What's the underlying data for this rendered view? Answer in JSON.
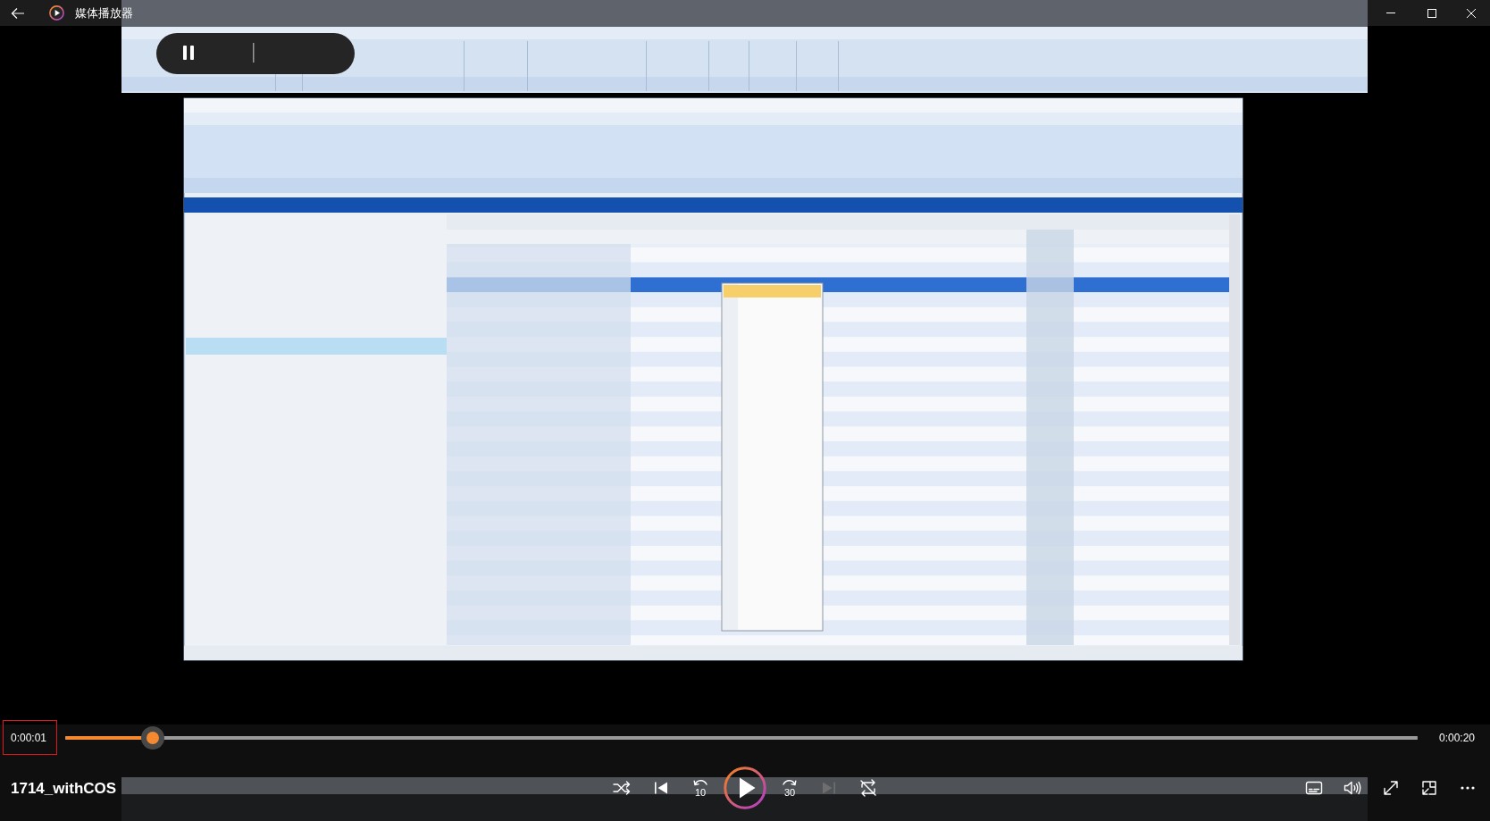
{
  "window": {
    "title": "媒体播放器"
  },
  "player": {
    "current_time": {
      "text": "0:00:01",
      "highlighted": true
    },
    "progress": {
      "level": 0.065
    },
    "total_time": "0:00:20",
    "media_title": "1714_withCOS",
    "playing": false,
    "repeat": false,
    "transport": [
      {
        "kind": "shuffle",
        "disabled": false
      },
      {
        "kind": "previous",
        "disabled": false
      },
      {
        "kind": "rewind",
        "label": "10",
        "disabled": false
      },
      {
        "kind": "play",
        "disabled": false
      },
      {
        "kind": "forward",
        "label": "30",
        "disabled": false
      },
      {
        "kind": "next",
        "disabled": true
      },
      {
        "kind": "repeat",
        "disabled": false
      }
    ],
    "options": [
      {
        "kind": "subtitles"
      },
      {
        "kind": "volume"
      },
      {
        "kind": "fullscreen"
      },
      {
        "kind": "mini_player"
      },
      {
        "kind": "more"
      }
    ]
  }
}
